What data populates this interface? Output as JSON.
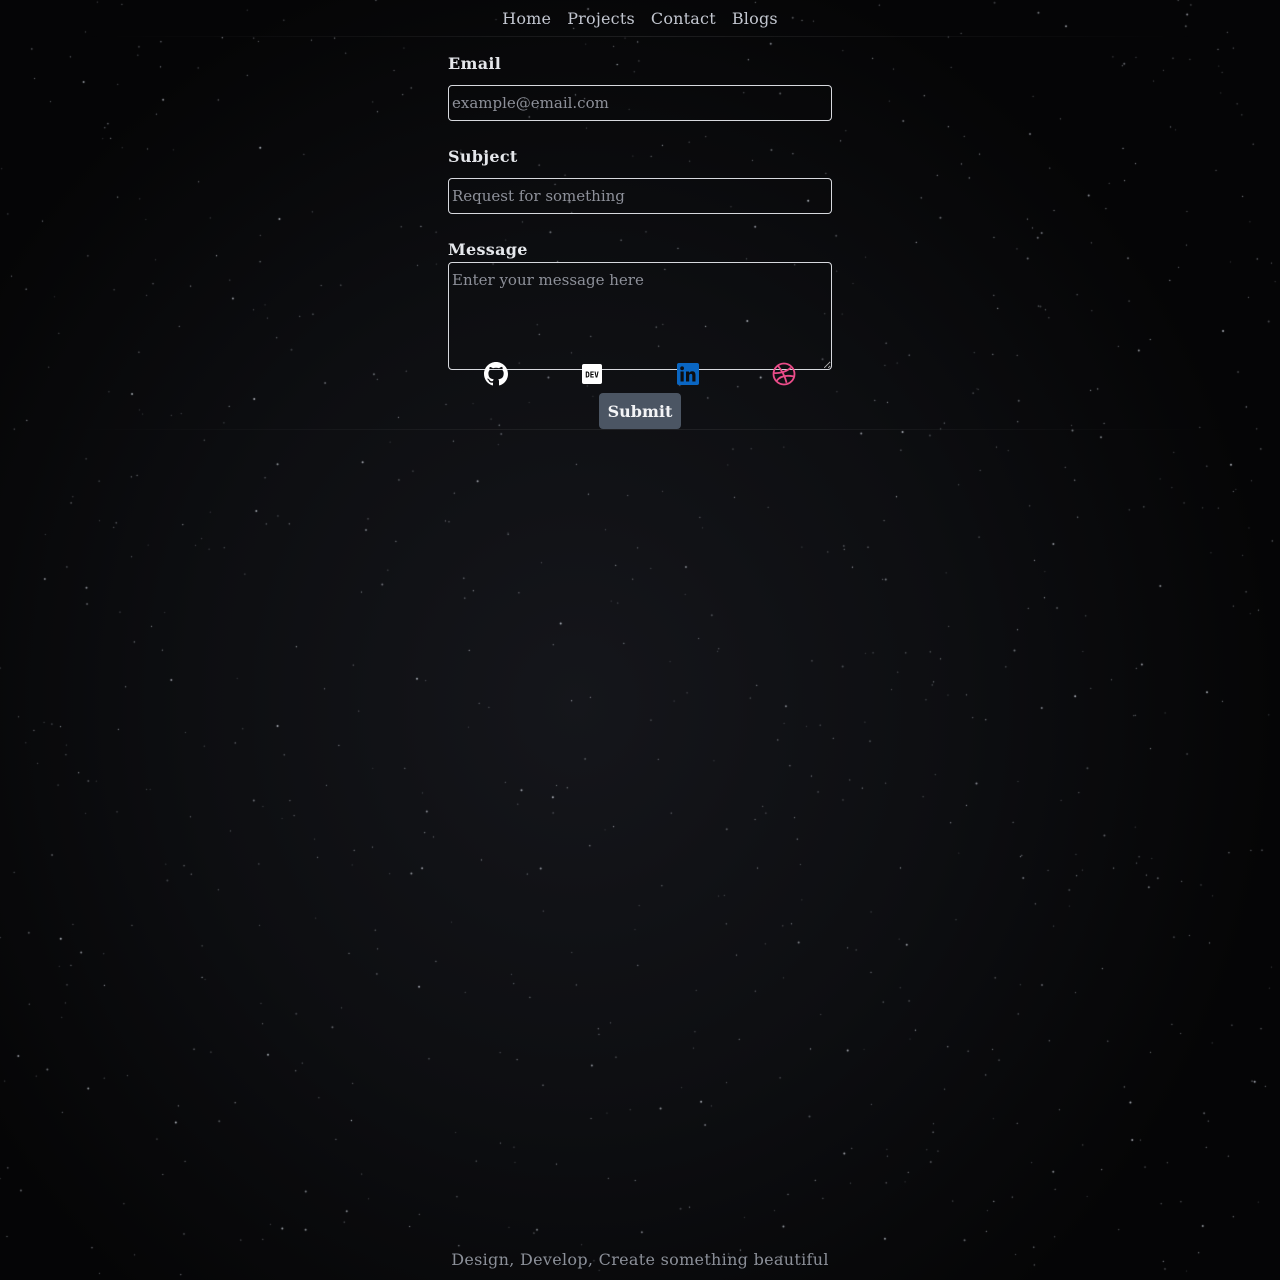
{
  "nav": {
    "items": [
      {
        "label": "Home"
      },
      {
        "label": "Projects"
      },
      {
        "label": "Contact"
      },
      {
        "label": "Blogs"
      }
    ]
  },
  "form": {
    "email": {
      "label": "Email",
      "placeholder": "example@email.com",
      "value": ""
    },
    "subject": {
      "label": "Subject",
      "placeholder": "Request for something",
      "value": ""
    },
    "message": {
      "label": "Message",
      "placeholder": "Enter your message here",
      "value": ""
    },
    "submit_label": "Submit"
  },
  "social": [
    {
      "icon": "github-icon",
      "color": "#ffffff"
    },
    {
      "icon": "dev-to-icon",
      "color": "#ffffff"
    },
    {
      "icon": "linkedin-icon",
      "color": "#0a66c2"
    },
    {
      "icon": "dribbble-icon",
      "color": "#ea4c89"
    }
  ],
  "footer": {
    "tagline": "Design, Develop, Create something beautiful"
  },
  "colors": {
    "background": "#0d0e11",
    "submit_bg": "#4b5563",
    "field_border": "#d7d9de"
  }
}
